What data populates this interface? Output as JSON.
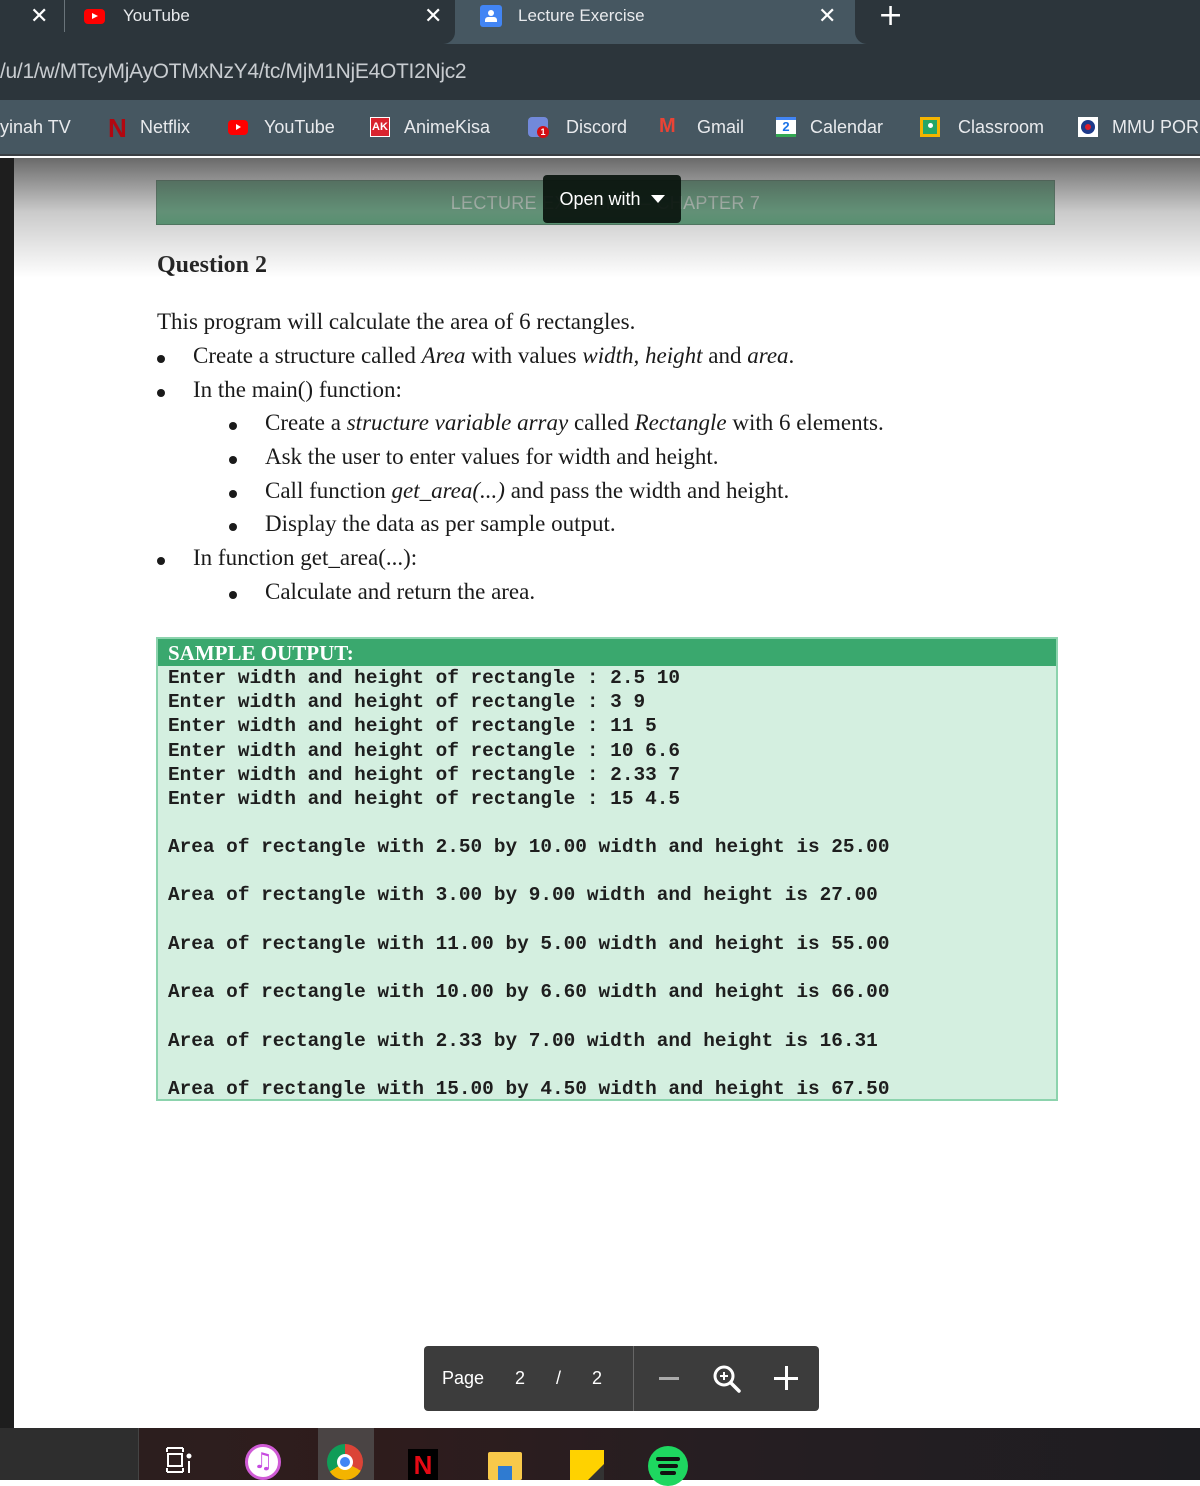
{
  "browser": {
    "tabs": [
      {
        "title": "YouTube",
        "icon": "youtube-icon",
        "active": false
      },
      {
        "title": "Lecture Exercise",
        "icon": "google-classroom-icon",
        "active": true
      }
    ],
    "close_glyph": "✕",
    "new_tab_glyph": "+",
    "url": "/u/1/w/MTcyMjAyOTMxNzY4/tc/MjM1NjE4OTI2Njc2",
    "bookmarks": [
      {
        "label": "yinah TV",
        "icon": "none"
      },
      {
        "label": "Netflix",
        "icon": "netflix-icon"
      },
      {
        "label": "YouTube",
        "icon": "youtube-icon"
      },
      {
        "label": "AnimeKisa",
        "icon": "animekisa-icon",
        "icon_text": "AK"
      },
      {
        "label": "Discord",
        "icon": "discord-icon",
        "badge": "1"
      },
      {
        "label": "Gmail",
        "icon": "gmail-icon"
      },
      {
        "label": "Calendar",
        "icon": "calendar-icon",
        "icon_text": "2"
      },
      {
        "label": "Classroom",
        "icon": "classroom-icon"
      },
      {
        "label": "MMU POR",
        "icon": "mmu-portal-icon"
      }
    ]
  },
  "viewer": {
    "open_with_label": "Open with",
    "page_label": "Page",
    "current_page": "2",
    "page_separator": "/",
    "total_pages": "2"
  },
  "document": {
    "header_banner": "LECTURE EXERCISE – CHAPTER 7",
    "question_title": "Question 2",
    "intro": "This program will calculate the area of 6 rectangles.",
    "bullets": {
      "b1": {
        "pre": "Create a structure called ",
        "em1": "Area",
        "mid": " with values ",
        "em2": "width, height",
        "mid2": " and ",
        "em3": "area",
        "post": "."
      },
      "b2": "In the main() function:",
      "b2_1": {
        "pre": "Create a ",
        "em1": "structure variable array",
        "mid": " called ",
        "em2": "Rectangle",
        "post": " with 6 elements."
      },
      "b2_2": "Ask the user to enter values for width and height.",
      "b2_3": {
        "pre": "Call function ",
        "em1": "get_area(...)",
        "post": " and pass the width and height."
      },
      "b2_4": "Display the data as per sample output.",
      "b3": "In function get_area(...):",
      "b3_1": "Calculate and return the area."
    },
    "sample_output": {
      "title": "SAMPLE OUTPUT:",
      "inputs": [
        "Enter width and height of rectangle : 2.5 10",
        "Enter width and height of rectangle : 3 9",
        "Enter width and height of rectangle : 11 5",
        "Enter width and height of rectangle : 10 6.6",
        "Enter width and height of rectangle : 2.33 7",
        "Enter width and height of rectangle : 15 4.5"
      ],
      "results": [
        "Area of rectangle with 2.50 by 10.00 width and height is 25.00",
        "Area of rectangle with 3.00 by 9.00 width and height is 27.00",
        "Area of rectangle with 11.00 by 5.00 width and height is 55.00",
        "Area of rectangle with 10.00 by 6.60 width and height is 66.00",
        "Area of rectangle with 2.33 by 7.00 width and height is 16.31",
        "Area of rectangle with 15.00 by 4.50 width and height is 67.50"
      ]
    }
  },
  "taskbar": {
    "apps": [
      "task-view",
      "itunes",
      "chrome",
      "netflix",
      "file-explorer",
      "sticky-notes",
      "spotify"
    ],
    "netflix_glyph": "N",
    "itunes_glyph": "♫"
  },
  "colors": {
    "banner_green": "#2e8b57",
    "sample_header_green": "#3aa86e",
    "sample_bg": "#d4efe0",
    "tab_bg": "#2c353b",
    "active_tab_bg": "#465761"
  }
}
